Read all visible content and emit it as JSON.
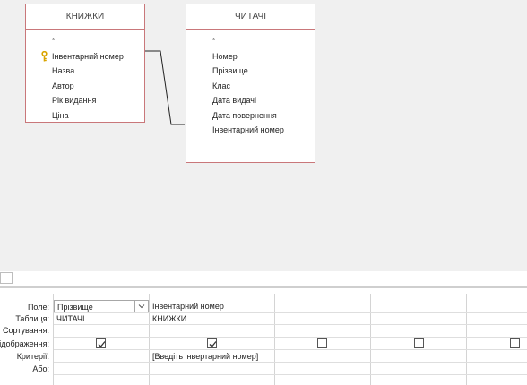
{
  "tables": {
    "books": {
      "title": "КНИЖКИ",
      "fields": [
        "*",
        "Інвентарний номер",
        "Назва",
        "Автор",
        "Рік видання",
        "Ціна"
      ],
      "primary_key_field": "Інвентарний номер"
    },
    "readers": {
      "title": "ЧИТАЧІ",
      "fields": [
        "*",
        "Номер",
        "Прізвище",
        "Клас",
        "Дата видачі",
        "Дата повернення",
        "Інвентарний номер"
      ]
    }
  },
  "grid": {
    "row_labels": {
      "field": "Поле:",
      "table": "Таблиця:",
      "sort": "Сортування:",
      "show": "Відображення:",
      "criteria": "Критерії:",
      "or": "Або:"
    },
    "columns": [
      {
        "field": "Прізвище",
        "table": "ЧИТАЧІ",
        "show": true,
        "criteria": ""
      },
      {
        "field": "Інвентарний номер",
        "table": "КНИЖКИ",
        "show": true,
        "criteria": "[Введіть інвертарний номер]"
      },
      {
        "field": "",
        "table": "",
        "show": false,
        "criteria": ""
      },
      {
        "field": "",
        "table": "",
        "show": false,
        "criteria": ""
      },
      {
        "field": "",
        "table": "",
        "show": false,
        "criteria": ""
      }
    ]
  },
  "icons": {
    "primary_key": "key-icon",
    "dropdown": "chevron-down-icon",
    "checkbox_checked": "checkmark-icon"
  },
  "colors": {
    "table_border": "#c9777a",
    "diagram_background": "#f0f0f0",
    "key_icon": "#d9a400"
  }
}
